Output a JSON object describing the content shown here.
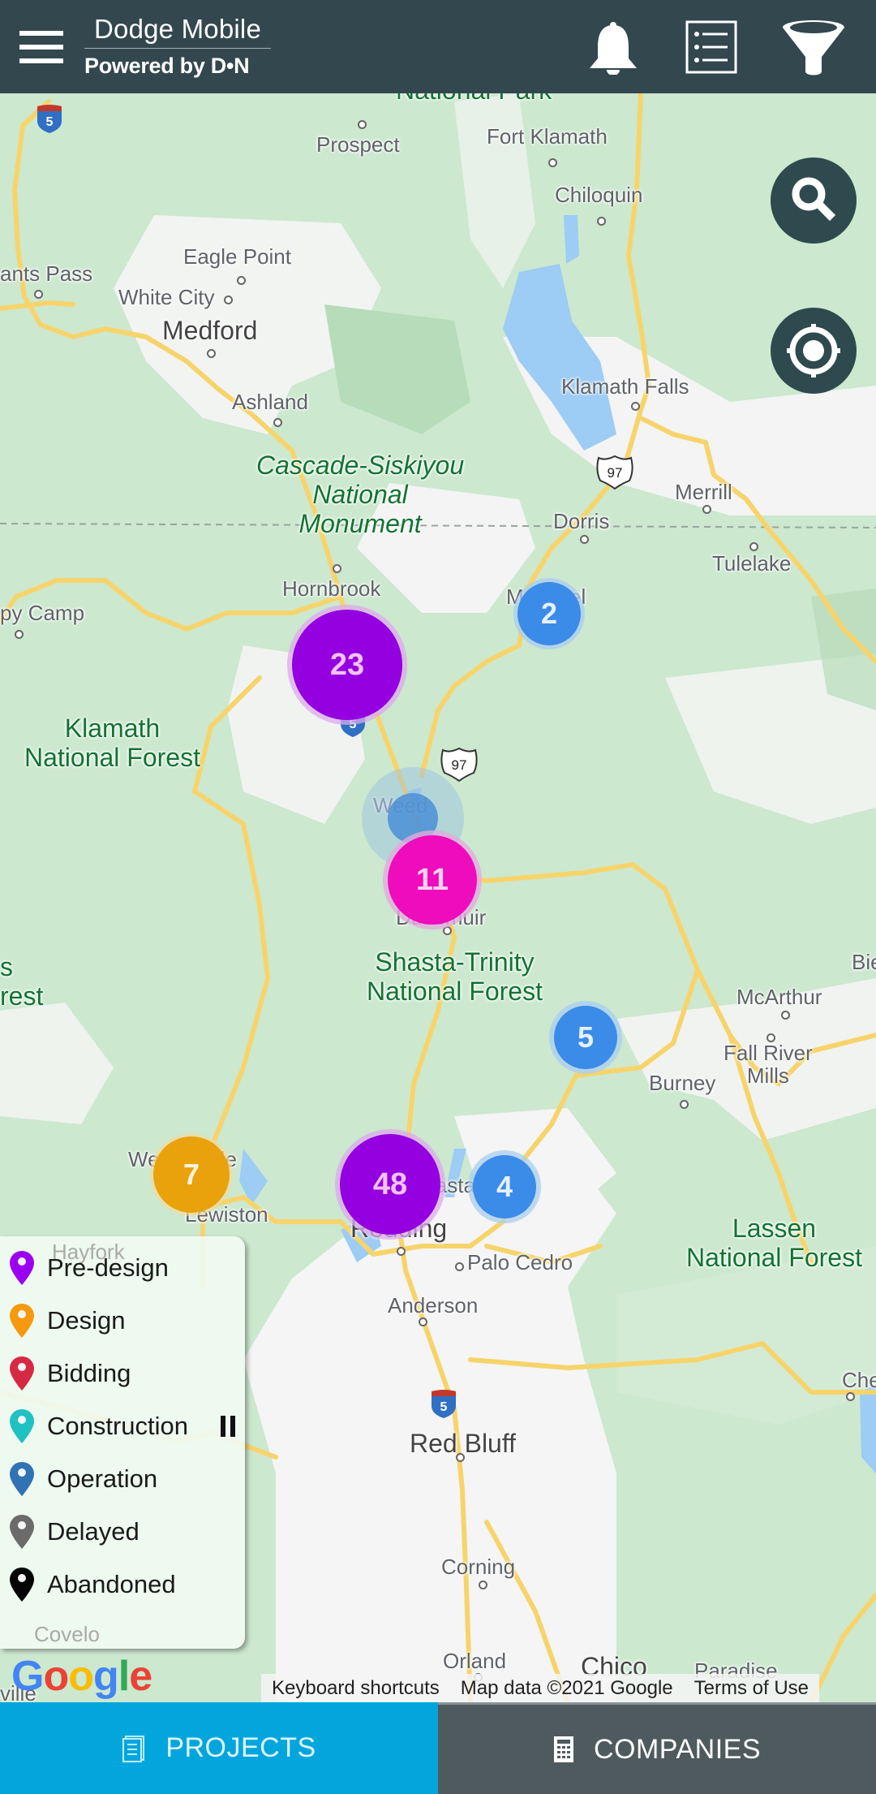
{
  "header": {
    "app_title": "Dodge Mobile",
    "powered_by": "Powered by D•N",
    "menu_icon": "hamburger-menu-icon",
    "actions": [
      {
        "name": "notifications",
        "icon": "bell-icon"
      },
      {
        "name": "list-view",
        "icon": "list-icon"
      },
      {
        "name": "filter",
        "icon": "funnel-filter-icon"
      }
    ]
  },
  "map": {
    "floating_buttons": [
      {
        "name": "search",
        "icon": "search-icon"
      },
      {
        "name": "my-location",
        "icon": "crosshair-location-icon"
      }
    ],
    "place_labels": {
      "national_park": "National Park",
      "prospect": "Prospect",
      "fort_klamath": "Fort Klamath",
      "chiloquin": "Chiloquin",
      "eagle_point": "Eagle Point",
      "grants_pass": "ants Pass",
      "white_city": "White City",
      "medford": "Medford",
      "ashland": "Ashland",
      "klamath_falls": "Klamath Falls",
      "cascade_siskiyou": "Cascade-Siskiyou\nNational\nMonument",
      "merrill": "Merrill",
      "dorris": "Dorris",
      "tulelake": "Tulelake",
      "hornbrook": "Hornbrook",
      "happy_camp": "py Camp",
      "macdoel": "Macdoel",
      "klamath_nf": "Klamath\nNational Forest",
      "weed": "Weed",
      "dunsmuir": "Dunsmuir",
      "shasta_trinity": "Shasta-Trinity\nNational Forest",
      "trinity_left": "s\nrest",
      "bieber": "Bie",
      "mcarthur": "McArthur",
      "fall_river_mills": "Fall River\nMills",
      "burney": "Burney",
      "weaverville": "Weaverville",
      "lewiston": "Lewiston",
      "shasta_lake": "Shasta Lake",
      "redding": "Redding",
      "palo_cedro": "Palo Cedro",
      "lassen_nf": "Lassen\nNational Forest",
      "anderson": "Anderson",
      "chester": "Cheste",
      "red_bluff": "Red Bluff",
      "corning": "Corning",
      "hayfork": "Hayfork",
      "covelo": "Covelo",
      "orland": "Orland",
      "chico": "Chico",
      "paradise": "Paradise",
      "willows": "ville"
    },
    "route_shields": {
      "i5": "5",
      "us97": "97"
    },
    "clusters": [
      {
        "count": "23",
        "stage": "Pre-design",
        "color": "#9400e0",
        "text_color": "#f3c2f5"
      },
      {
        "count": "2",
        "stage": "Operation",
        "color": "#3b8be8",
        "text_color": "#e6f0ff"
      },
      {
        "count": "",
        "stage": "Operation",
        "color": "#4a8fd6",
        "text_color": "#ffffff"
      },
      {
        "count": "11",
        "stage": "Bidding",
        "color": "#ee0cbd",
        "text_color": "#fbd3f0"
      },
      {
        "count": "5",
        "stage": "Operation",
        "color": "#3b8be8",
        "text_color": "#e6f0ff"
      },
      {
        "count": "7",
        "stage": "Design",
        "color": "#eaa20c",
        "text_color": "#fff4dc"
      },
      {
        "count": "48",
        "stage": "Pre-design",
        "color": "#9400e0",
        "text_color": "#f3c2f5"
      },
      {
        "count": "4",
        "stage": "Operation",
        "color": "#3b8be8",
        "text_color": "#e6f0ff"
      }
    ],
    "legend": {
      "items": [
        {
          "label": "Pre-design",
          "color": "#9b00f0"
        },
        {
          "label": "Design",
          "color": "#f59a0f"
        },
        {
          "label": "Bidding",
          "color": "#d62a44"
        },
        {
          "label": "Construction",
          "color": "#1fc1c3"
        },
        {
          "label": "Operation",
          "color": "#2f73b4"
        },
        {
          "label": "Delayed",
          "color": "#6b6b6b"
        },
        {
          "label": "Abandoned",
          "color": "#050505"
        }
      ],
      "pause_icon": "pause-icon"
    },
    "attribution": {
      "logo": "Google",
      "keyboard_shortcuts": "Keyboard shortcuts",
      "map_data": "Map data ©2021 Google",
      "terms": "Terms of Use"
    }
  },
  "tabs": [
    {
      "label": "PROJECTS",
      "icon": "document-icon",
      "active": true
    },
    {
      "label": "COMPANIES",
      "icon": "building-icon",
      "active": false
    }
  ]
}
